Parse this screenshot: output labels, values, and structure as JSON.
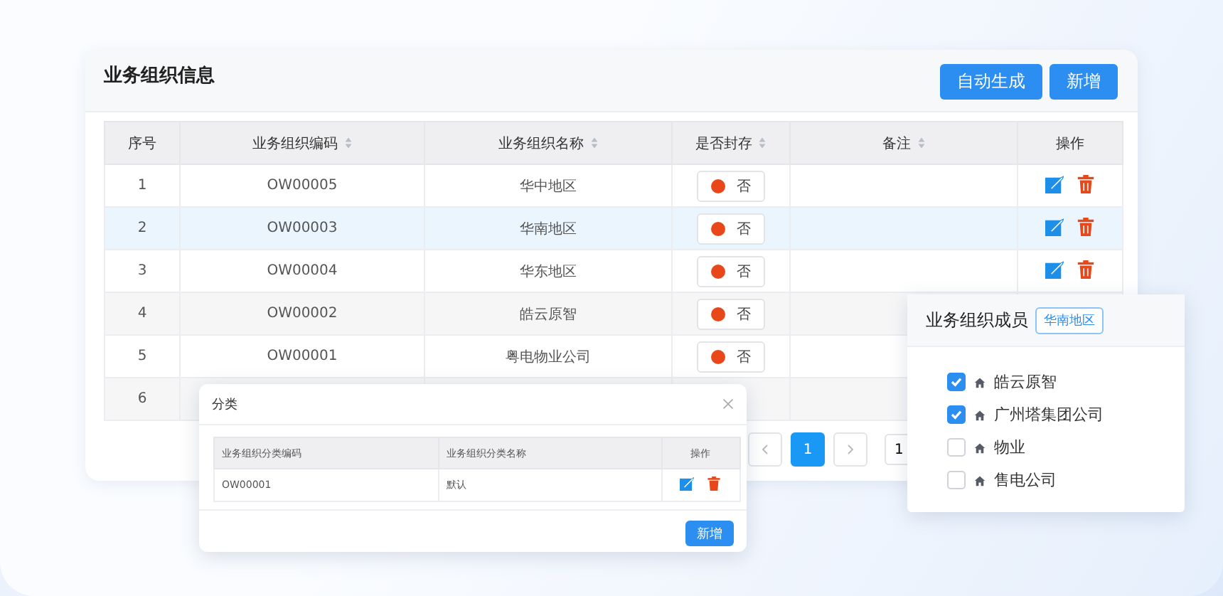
{
  "main": {
    "title": "业务组织信息",
    "buttons": [
      "自动生成",
      "新增"
    ],
    "columns": [
      {
        "label": "序号",
        "sortable": false
      },
      {
        "label": "业务组织编码",
        "sortable": true
      },
      {
        "label": "业务组织名称",
        "sortable": true
      },
      {
        "label": "是否封存",
        "sortable": true
      },
      {
        "label": "备注",
        "sortable": true
      },
      {
        "label": "操作",
        "sortable": false
      }
    ],
    "rows": [
      {
        "index": "1",
        "code": "OW00005",
        "name": "华中地区",
        "sealed": {
          "on": false,
          "label": "否"
        },
        "selected": false,
        "actions": [
          {
            "kind": "edit"
          },
          {
            "kind": "delete"
          }
        ]
      },
      {
        "index": "2",
        "code": "OW00003",
        "name": "华南地区",
        "sealed": {
          "on": false,
          "label": "否"
        },
        "selected": true,
        "actions": [
          {
            "kind": "edit"
          },
          {
            "kind": "delete"
          }
        ]
      },
      {
        "index": "3",
        "code": "OW00004",
        "name": "华东地区",
        "sealed": {
          "on": false,
          "label": "否"
        },
        "selected": false,
        "actions": [
          {
            "kind": "edit"
          },
          {
            "kind": "delete"
          }
        ]
      },
      {
        "index": "4",
        "code": "OW00002",
        "name": "皓云原智",
        "sealed": {
          "on": false,
          "label": "否"
        },
        "selected": false
      },
      {
        "index": "5",
        "code": "OW00001",
        "name": "粤电物业公司",
        "sealed": {
          "on": false,
          "label": "否"
        },
        "selected": false
      },
      {
        "index": "6",
        "selected": false
      }
    ],
    "pagination": {
      "pages": [
        {
          "label": "1",
          "selected": true
        }
      ],
      "jump": "1"
    }
  },
  "dialog": {
    "title": "分类",
    "columns": [
      "业务组织分类编码",
      "业务组织分类名称",
      "操作"
    ],
    "rows": [
      {
        "code": "OW00001",
        "name": "默认"
      }
    ],
    "button": "新增"
  },
  "members": {
    "title": "业务组织成员",
    "tag": "华南地区",
    "items": [
      {
        "label": "皓云原智",
        "checked": true
      },
      {
        "label": "广州塔集团公司",
        "checked": true
      },
      {
        "label": "物业",
        "checked": false
      },
      {
        "label": "售电公司",
        "checked": false
      }
    ]
  }
}
